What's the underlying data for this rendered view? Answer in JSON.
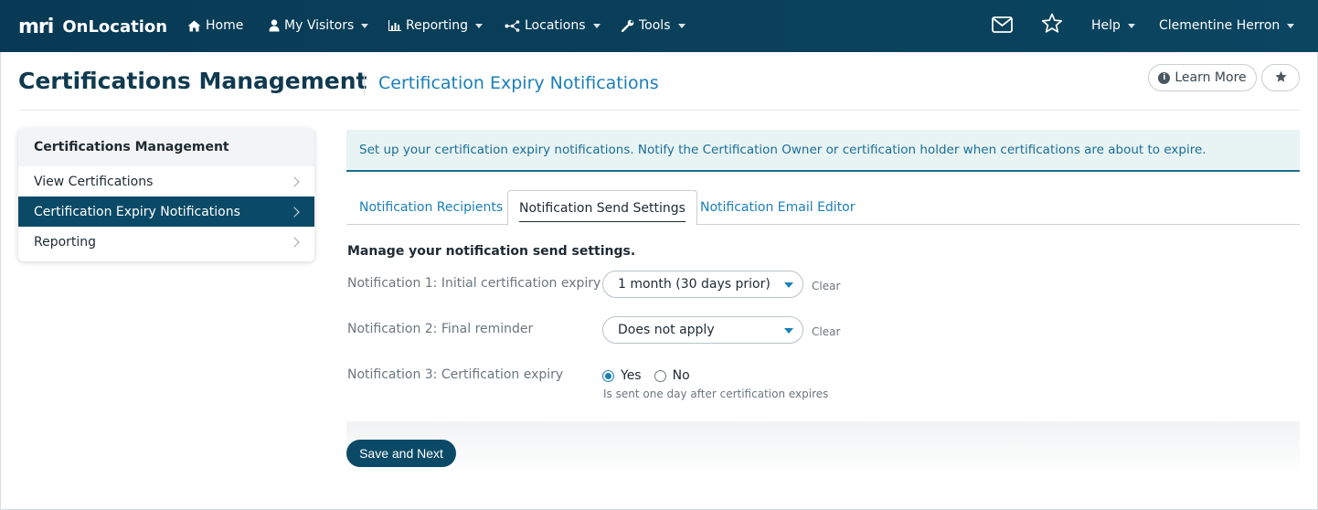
{
  "app": {
    "logo_mark": "mri",
    "name": "OnLocation"
  },
  "nav": {
    "items": [
      {
        "label": "Home",
        "icon": "home-icon"
      },
      {
        "label": "My Visitors",
        "icon": "user-icon"
      },
      {
        "label": "Reporting",
        "icon": "bar-chart-icon"
      },
      {
        "label": "Locations",
        "icon": "network-icon"
      },
      {
        "label": "Tools",
        "icon": "wrench-icon"
      }
    ],
    "help": "Help",
    "user": "Clementine Herron"
  },
  "header": {
    "title": "Certifications Management",
    "subtitle": "Certification Expiry Notifications",
    "learn_more": "Learn More",
    "info_glyph": "i"
  },
  "sidebar": {
    "heading": "Certifications Management",
    "items": [
      {
        "label": "View Certifications",
        "active": false
      },
      {
        "label": "Certification Expiry Notifications",
        "active": true
      },
      {
        "label": "Reporting",
        "active": false
      }
    ]
  },
  "banner": {
    "text": "Set up your certification expiry notifications. Notify the Certification Owner or certification holder when certifications are about to expire."
  },
  "tabs": [
    {
      "label": "Notification Recipients",
      "active": false
    },
    {
      "label": "Notification Send Settings",
      "active": true
    },
    {
      "label": "Notification Email Editor",
      "active": false
    }
  ],
  "form": {
    "title": "Manage your notification send settings.",
    "notification1": {
      "label": "Notification 1: Initial certification expiry",
      "value": "1 month (30 days prior)",
      "clear": "Clear"
    },
    "notification2": {
      "label": "Notification 2: Final reminder",
      "value": "Does not apply",
      "clear": "Clear"
    },
    "notification3": {
      "label": "Notification 3: Certification expiry",
      "options": [
        "Yes",
        "No"
      ],
      "selected": "Yes",
      "helper": "Is sent one day after certification expires"
    },
    "save_label": "Save and Next"
  },
  "colors": {
    "nav_bg": "#083a55",
    "accent_blue": "#1a7fb8",
    "primary_dark": "#0b4a66",
    "logo_green": "#7cc242",
    "banner_bg": "#e8f3f4"
  }
}
